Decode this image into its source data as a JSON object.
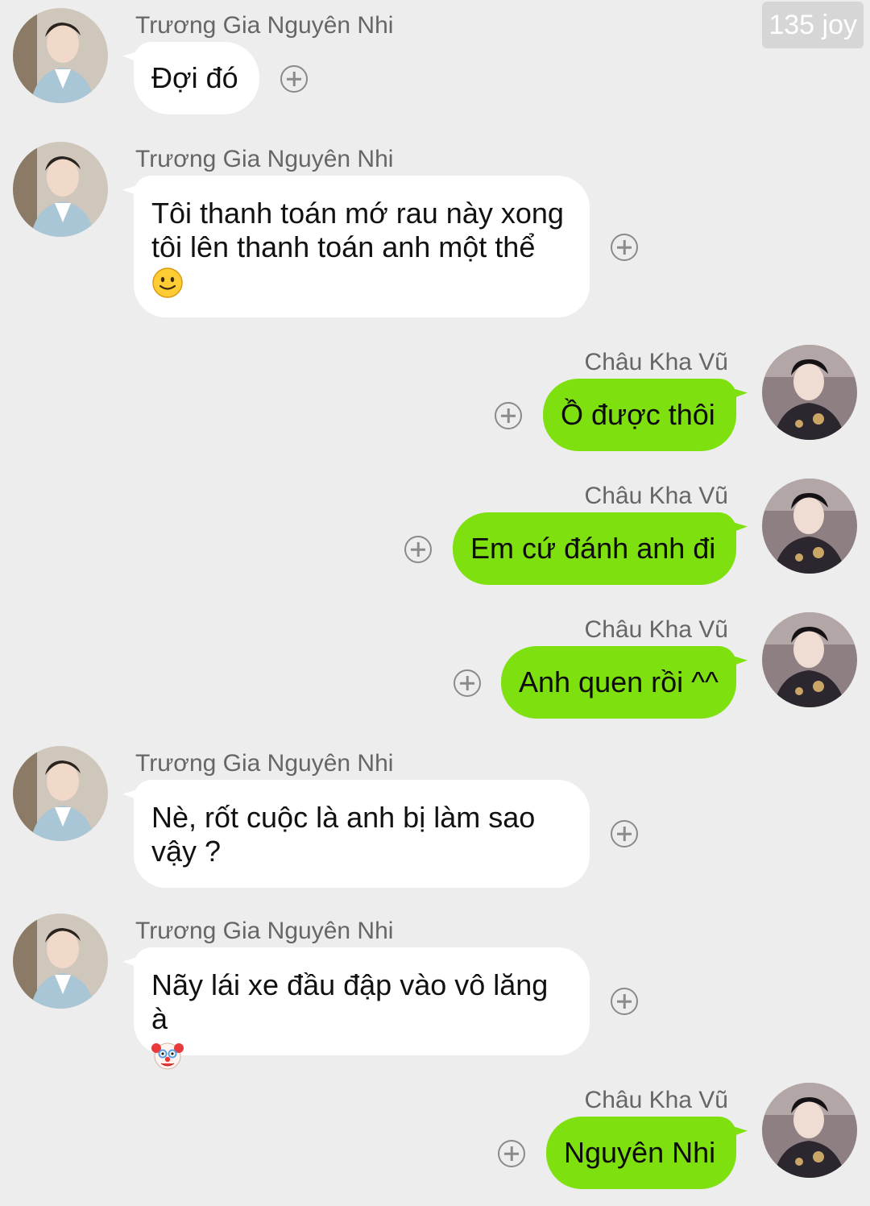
{
  "watermark": "135 joy",
  "contacts": {
    "left_name": "Trương Gia Nguyên Nhi",
    "right_name": "Châu Kha Vũ"
  },
  "messages": [
    {
      "side": "left",
      "sender": "Trương Gia Nguyên Nhi",
      "lines": [
        "Đợi đó"
      ]
    },
    {
      "side": "left",
      "sender": "Trương Gia Nguyên Nhi",
      "lines": [
        "Tôi thanh toán mớ rau này xong",
        "tôi lên thanh toán anh một thể"
      ],
      "emoji": "slightly-smiling-face"
    },
    {
      "side": "right",
      "sender": "Châu Kha Vũ",
      "lines": [
        "Ồ được thôi"
      ]
    },
    {
      "side": "right",
      "sender": "Châu Kha Vũ",
      "lines": [
        "Em cứ đánh anh đi"
      ]
    },
    {
      "side": "right",
      "sender": "Châu Kha Vũ",
      "lines": [
        "Anh quen rồi ^^"
      ]
    },
    {
      "side": "left",
      "sender": "Trương Gia Nguyên Nhi",
      "lines": [
        "Nè, rốt cuộc là anh bị làm sao",
        "vậy ?"
      ]
    },
    {
      "side": "left",
      "sender": "Trương Gia Nguyên Nhi",
      "lines": [
        "Nãy lái xe đầu đập vào vô lăng à"
      ],
      "emoji": "clown-face"
    },
    {
      "side": "right",
      "sender": "Châu Kha Vũ",
      "lines": [
        "Nguyên Nhi"
      ]
    }
  ],
  "icons": {
    "add": "plus-circle-icon",
    "avatar_left": "avatar-light-blue-suit",
    "avatar_right": "avatar-dark-outfit"
  },
  "colors": {
    "background": "#ededed",
    "bubble_sent": "#7fe010",
    "bubble_received": "#ffffff",
    "sender_text": "#666666",
    "watermark_bg": "#d6d6d6"
  }
}
